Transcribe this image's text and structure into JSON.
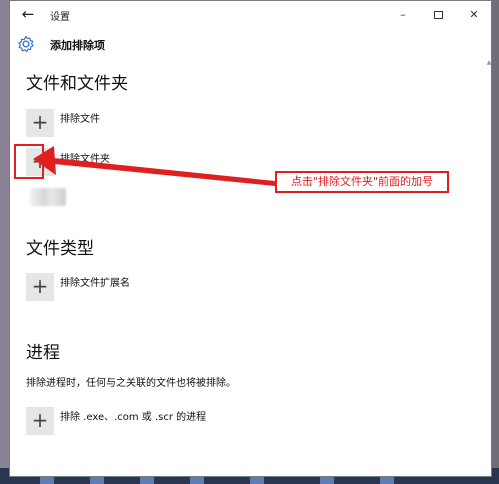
{
  "window": {
    "back_icon": "arrow-left-icon",
    "title": "设置",
    "minimize": "–",
    "close": "✕"
  },
  "header": {
    "icon": "gear-icon",
    "title": "添加排除项"
  },
  "sections": {
    "files_folders": {
      "title": "文件和文件夹",
      "add_file_label": "排除文件",
      "add_folder_label": "排除文件夹"
    },
    "file_types": {
      "title": "文件类型",
      "add_ext_label": "排除文件扩展名"
    },
    "processes": {
      "title": "进程",
      "description": "排除进程时，任何与之关联的文件也将被排除。",
      "add_process_label": "排除 .exe、.com 或 .scr 的进程"
    }
  },
  "add_symbol": "+",
  "annotation": {
    "callout_text": "点击\"排除文件夹\"前面的加号",
    "color": "#e02020"
  }
}
